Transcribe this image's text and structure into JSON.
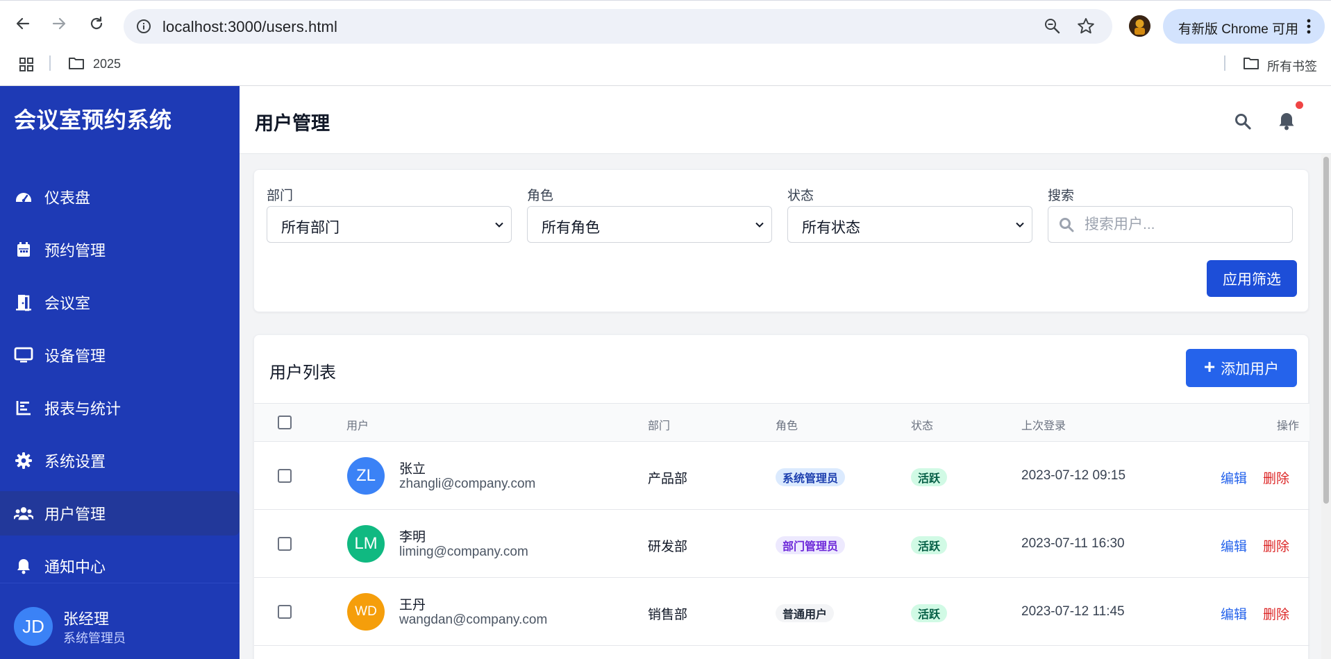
{
  "browser": {
    "url": "localhost:3000/users.html",
    "update_label": "有新版 Chrome 可用",
    "bookmark_folder": "2025",
    "all_bookmarks": "所有书签"
  },
  "sidebar": {
    "title": "会议室预约系统",
    "items": [
      {
        "label": "仪表盘",
        "icon": "dashboard-icon"
      },
      {
        "label": "预约管理",
        "icon": "calendar-icon"
      },
      {
        "label": "会议室",
        "icon": "door-icon"
      },
      {
        "label": "设备管理",
        "icon": "monitor-icon"
      },
      {
        "label": "报表与统计",
        "icon": "chart-icon"
      },
      {
        "label": "系统设置",
        "icon": "gear-icon"
      },
      {
        "label": "用户管理",
        "icon": "users-icon",
        "active": true
      },
      {
        "label": "通知中心",
        "icon": "bell-icon"
      }
    ],
    "user": {
      "initials": "JD",
      "name": "张经理",
      "role": "系统管理员"
    }
  },
  "header": {
    "title": "用户管理"
  },
  "filters": {
    "department": {
      "label": "部门",
      "value": "所有部门"
    },
    "role": {
      "label": "角色",
      "value": "所有角色"
    },
    "status": {
      "label": "状态",
      "value": "所有状态"
    },
    "search": {
      "label": "搜索",
      "placeholder": "搜索用户..."
    },
    "apply_label": "应用筛选"
  },
  "user_list": {
    "title": "用户列表",
    "add_label": "添加用户",
    "columns": [
      "用户",
      "部门",
      "角色",
      "状态",
      "上次登录",
      "操作"
    ],
    "rows": [
      {
        "initials": "ZL",
        "avatar_color": "#3b82f6",
        "name": "张立",
        "email": "zhangli@company.com",
        "department": "产品部",
        "role": "系统管理员",
        "role_bg": "#dbeafe",
        "role_fg": "#1e40af",
        "status": "活跃",
        "last_login": "2023-07-12 09:15",
        "edit": "编辑",
        "delete": "删除"
      },
      {
        "initials": "LM",
        "avatar_color": "#10b981",
        "name": "李明",
        "email": "liming@company.com",
        "department": "研发部",
        "role": "部门管理员",
        "role_bg": "#ede9fe",
        "role_fg": "#6d28d9",
        "status": "活跃",
        "last_login": "2023-07-11 16:30",
        "edit": "编辑",
        "delete": "删除"
      },
      {
        "initials": "WD",
        "avatar_color": "#f59e0b",
        "name": "王丹",
        "email": "wangdan@company.com",
        "department": "销售部",
        "role": "普通用户",
        "role_bg": "#f3f4f6",
        "role_fg": "#1f2937",
        "status": "活跃",
        "last_login": "2023-07-12 11:45",
        "edit": "编辑",
        "delete": "删除"
      }
    ]
  },
  "colors": {
    "sidebar": "#1e3ab5",
    "primary": "#2563eb",
    "danger": "#dc2626",
    "status_bg": "#d1fae5",
    "status_fg": "#065f46"
  }
}
